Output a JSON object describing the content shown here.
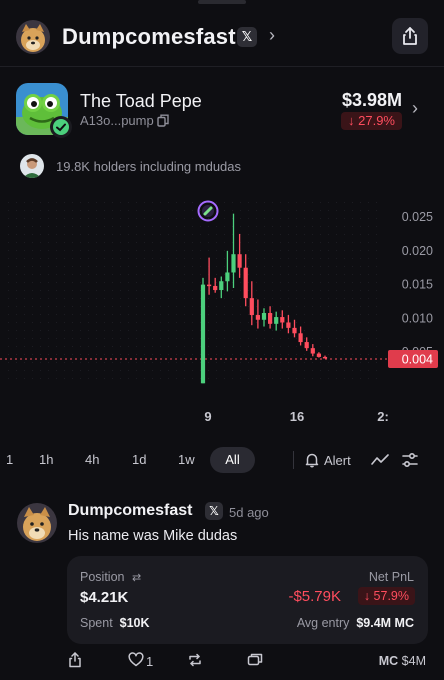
{
  "header": {
    "title": "Dumpcomesfast",
    "x_badge": "𝕏"
  },
  "token": {
    "name": "The Toad Pepe",
    "address": "A13o...pump",
    "price": "$3.98M",
    "change": "↓ 27.9%"
  },
  "holders": {
    "text": "19.8K holders including mdudas"
  },
  "chart_data": {
    "type": "candlestick",
    "y_ticks": [
      "0.025",
      "0.020",
      "0.015",
      "0.010",
      "0.005"
    ],
    "x_ticks": [
      "9",
      "16",
      "2:"
    ],
    "current_price_label": "0.004",
    "current_price": 0.004,
    "ylim": [
      0.0,
      0.029
    ],
    "colors": {
      "up": "#4cd07d",
      "down": "#ff4d5e",
      "marker": "#a56bff"
    },
    "candles": [
      {
        "o": 0.0004,
        "h": 0.016,
        "l": 0.0004,
        "c": 0.015
      },
      {
        "o": 0.015,
        "h": 0.019,
        "l": 0.0135,
        "c": 0.0148
      },
      {
        "o": 0.0148,
        "h": 0.016,
        "l": 0.0138,
        "c": 0.0142
      },
      {
        "o": 0.0142,
        "h": 0.0162,
        "l": 0.013,
        "c": 0.0155
      },
      {
        "o": 0.0155,
        "h": 0.02,
        "l": 0.014,
        "c": 0.0168
      },
      {
        "o": 0.0168,
        "h": 0.0255,
        "l": 0.0145,
        "c": 0.0195
      },
      {
        "o": 0.0195,
        "h": 0.0225,
        "l": 0.016,
        "c": 0.0175
      },
      {
        "o": 0.0175,
        "h": 0.0195,
        "l": 0.0118,
        "c": 0.013
      },
      {
        "o": 0.013,
        "h": 0.0155,
        "l": 0.009,
        "c": 0.0105
      },
      {
        "o": 0.0105,
        "h": 0.0128,
        "l": 0.0085,
        "c": 0.0098
      },
      {
        "o": 0.0098,
        "h": 0.0115,
        "l": 0.0088,
        "c": 0.0108
      },
      {
        "o": 0.0108,
        "h": 0.0118,
        "l": 0.0085,
        "c": 0.0092
      },
      {
        "o": 0.0092,
        "h": 0.011,
        "l": 0.0082,
        "c": 0.0102
      },
      {
        "o": 0.0102,
        "h": 0.0112,
        "l": 0.0085,
        "c": 0.0094
      },
      {
        "o": 0.0094,
        "h": 0.0105,
        "l": 0.0078,
        "c": 0.0086
      },
      {
        "o": 0.0086,
        "h": 0.0098,
        "l": 0.0072,
        "c": 0.0078
      },
      {
        "o": 0.0078,
        "h": 0.0088,
        "l": 0.006,
        "c": 0.0065
      },
      {
        "o": 0.0065,
        "h": 0.0072,
        "l": 0.0052,
        "c": 0.0056
      },
      {
        "o": 0.0056,
        "h": 0.0062,
        "l": 0.0044,
        "c": 0.0048
      },
      {
        "o": 0.0048,
        "h": 0.005,
        "l": 0.0042,
        "c": 0.0043
      },
      {
        "o": 0.0043,
        "h": 0.0045,
        "l": 0.0041,
        "c": 0.0042
      }
    ]
  },
  "timeframes": [
    "1",
    "1h",
    "4h",
    "1d",
    "1w",
    "All"
  ],
  "alert_label": "Alert",
  "post": {
    "author": "Dumpcomesfast",
    "x_badge": "𝕏",
    "ago": "5d ago",
    "text": "His name was Mike dudas"
  },
  "position": {
    "label": "Position",
    "swap_icon": "⇄",
    "value": "$4.21K",
    "pnl_label": "Net PnL",
    "pnl_value": "-$5.79K",
    "pnl_change": "↓ 57.9%",
    "spent_label": "Spent",
    "spent_value": "$10K",
    "avg_label": "Avg entry",
    "avg_value": "$9.4M MC"
  },
  "actions": {
    "likes": "1",
    "mc_label": "MC",
    "mc_value": "$4M"
  }
}
